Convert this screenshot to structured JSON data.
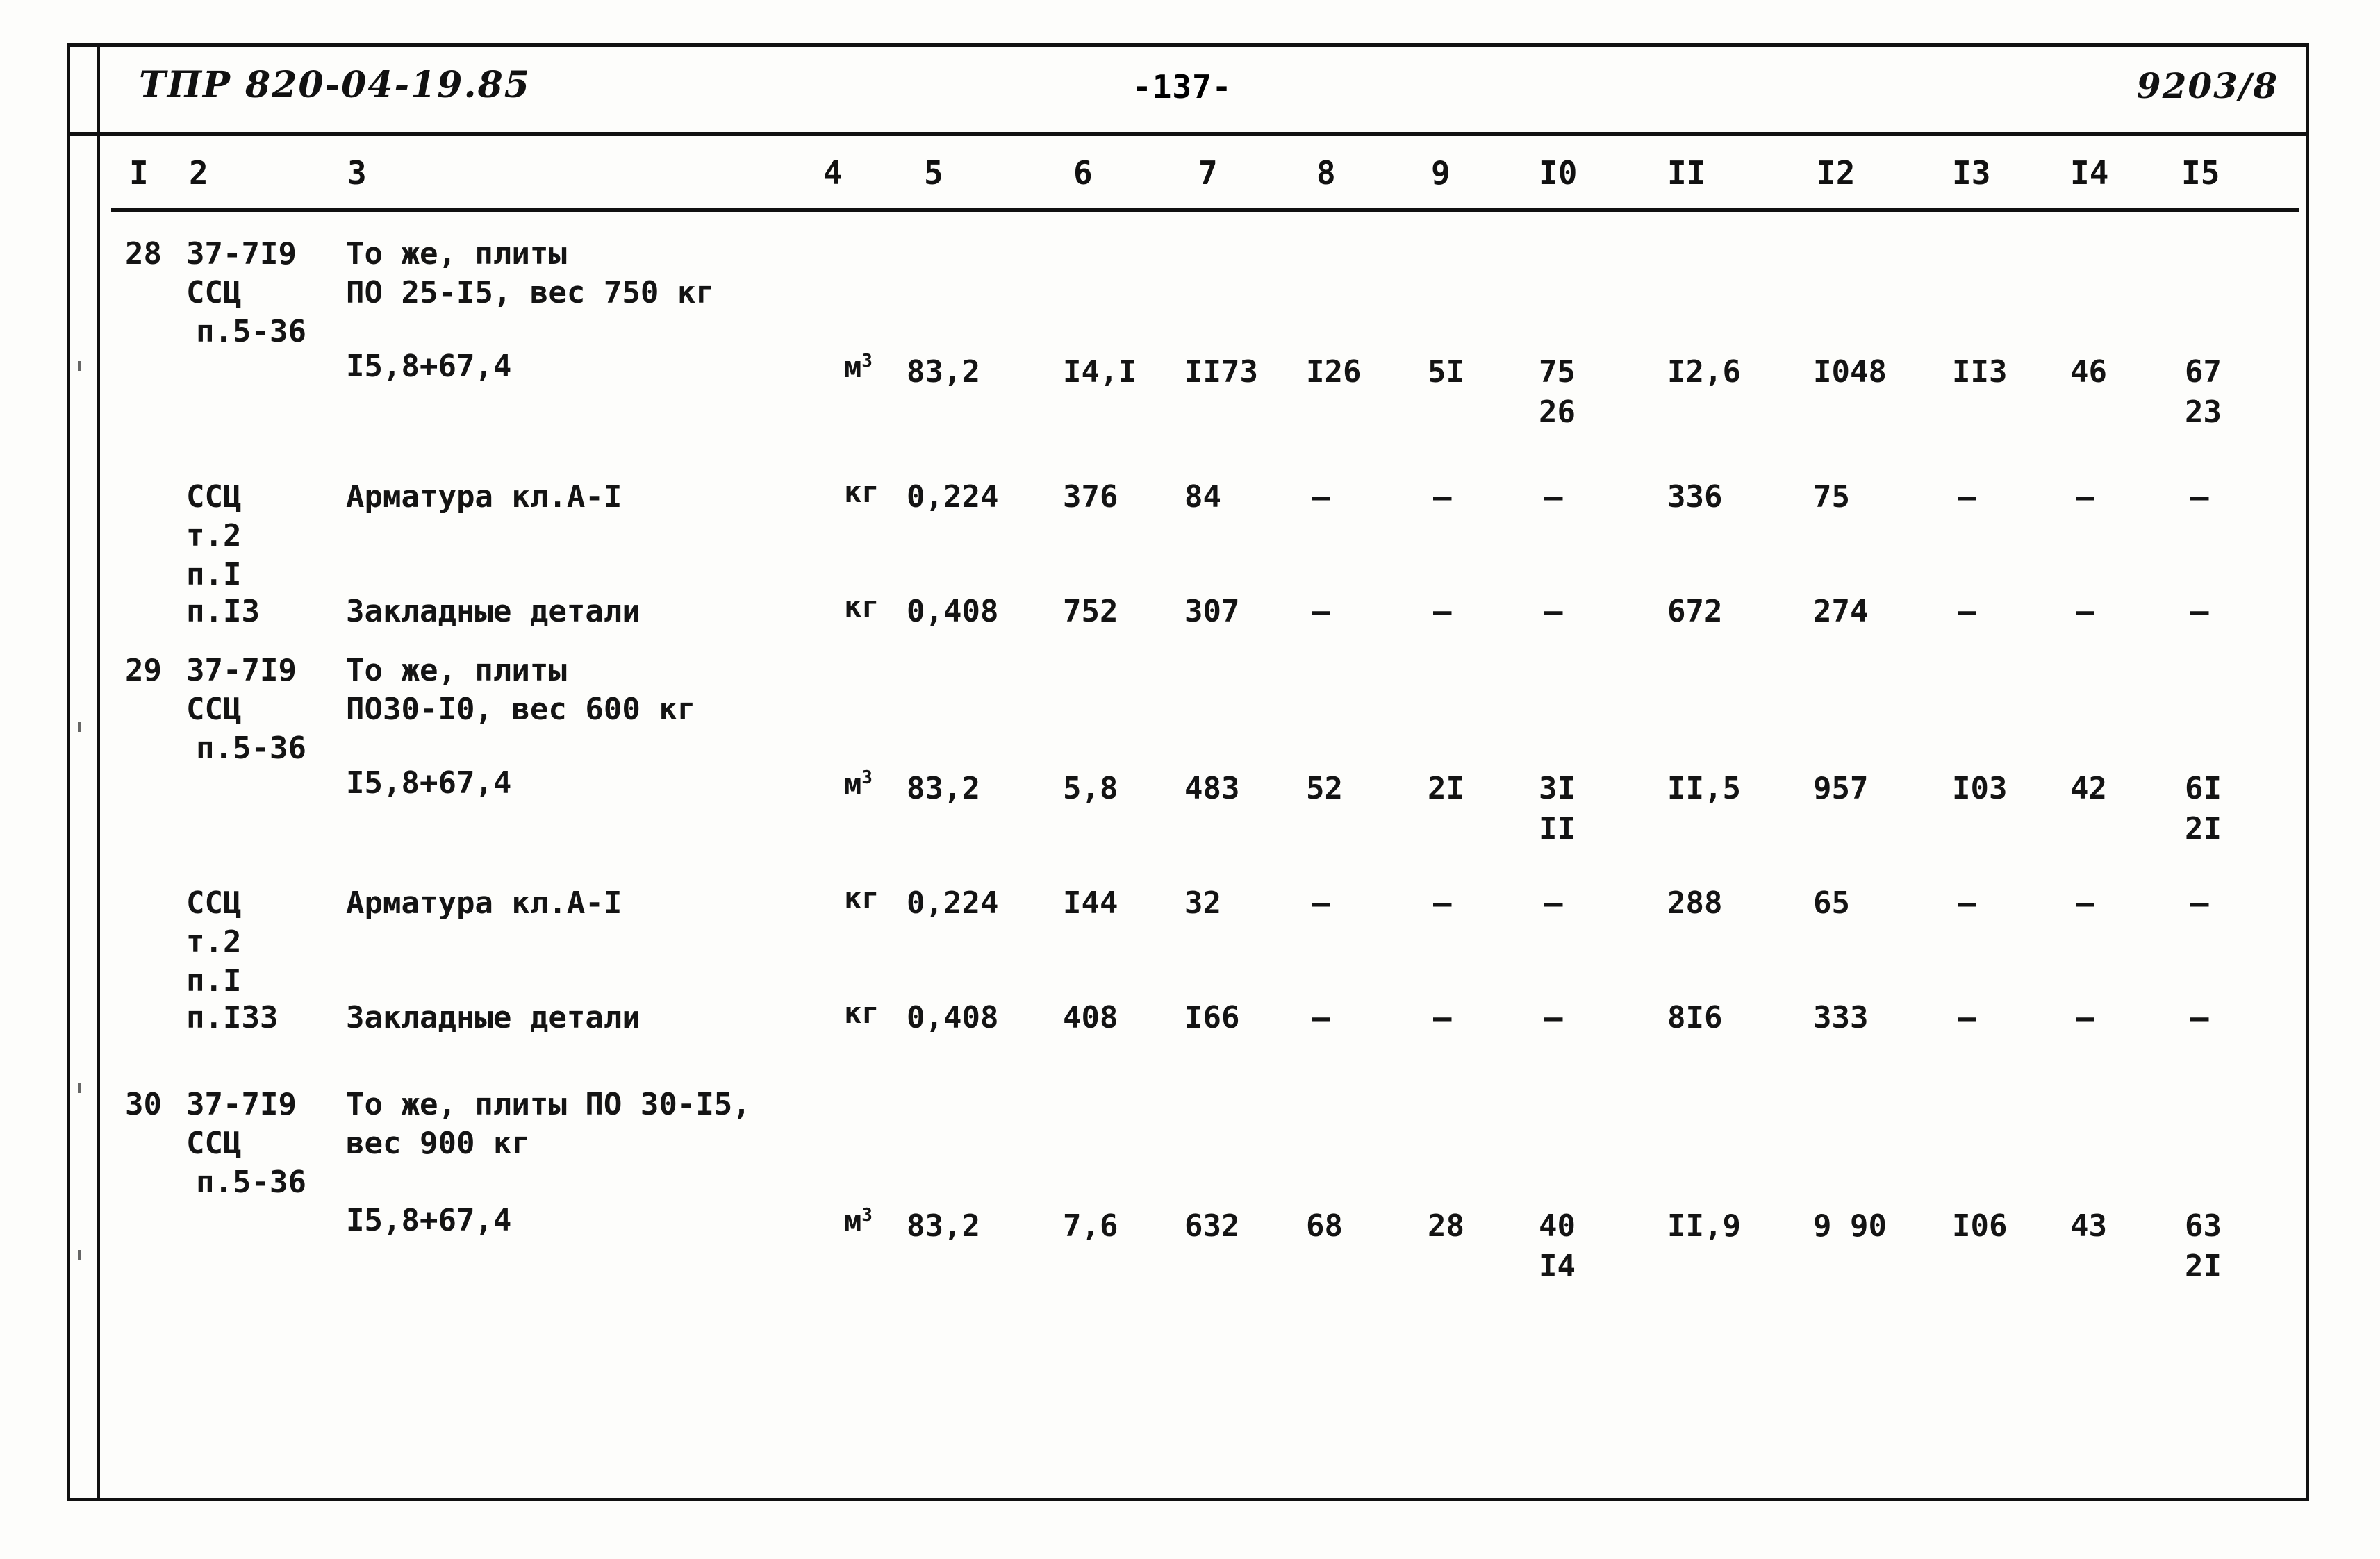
{
  "header": {
    "doc_code": "ТПР 820-04-19.85",
    "page_number": "-137-",
    "sheet_code": "9203/8"
  },
  "table": {
    "column_headers": [
      "I",
      "2",
      "3",
      "4",
      "5",
      "6",
      "7",
      "8",
      "9",
      "I0",
      "II",
      "I2",
      "I3",
      "I4",
      "I5"
    ],
    "rows": [
      {
        "id": "row-28",
        "c1": "28",
        "c2_lines": [
          "37-7I9",
          "ССЦ",
          "п.5-36"
        ],
        "c3_lines": [
          "То же, плиты",
          "ПО 25-I5, вес 750 кг",
          "I5,8+67,4"
        ],
        "c4": "м",
        "c4_sup": "3",
        "c5": "83,2",
        "c6": "I4,I",
        "c7": "II73",
        "c8": "I26",
        "c9": "5I",
        "c10": "75",
        "c10b": "26",
        "c11": "I2,6",
        "c12": "I048",
        "c13": "II3",
        "c14": "46",
        "c15": "67",
        "c15b": "23"
      },
      {
        "id": "row-28-armatura",
        "c1": "",
        "c2_lines": [
          "ССЦ",
          "т.2",
          "п.I"
        ],
        "c3_lines": [
          "Арматура кл.А-I"
        ],
        "c4": "кг",
        "c4_sup": "",
        "c5": "0,224",
        "c6": "376",
        "c7": "84",
        "c8": "-",
        "c9": "-",
        "c10": "-",
        "c11": "336",
        "c12": "75",
        "c13": "-",
        "c14": "-",
        "c15": "-"
      },
      {
        "id": "row-28-zakladnye",
        "c1": "",
        "c2_lines": [
          "п.I3"
        ],
        "c3_lines": [
          "Закладные детали"
        ],
        "c4": "кг",
        "c4_sup": "",
        "c5": "0,408",
        "c6": "752",
        "c7": "307",
        "c8": "-",
        "c9": "-",
        "c10": "-",
        "c11": "672",
        "c12": "274",
        "c13": "-",
        "c14": "-",
        "c15": "-"
      },
      {
        "id": "row-29",
        "c1": "29",
        "c2_lines": [
          "37-7I9",
          "ССЦ",
          "п.5-36"
        ],
        "c3_lines": [
          "То же, плиты",
          "ПО30-I0, вес 600 кг",
          "I5,8+67,4"
        ],
        "c4": "м",
        "c4_sup": "3",
        "c5": "83,2",
        "c6": "5,8",
        "c7": "483",
        "c8": "52",
        "c9": "2I",
        "c10": "3I",
        "c10b": "II",
        "c11": "II,5",
        "c12": "957",
        "c13": "I03",
        "c14": "42",
        "c15": "6I",
        "c15b": "2I"
      },
      {
        "id": "row-29-armatura",
        "c1": "",
        "c2_lines": [
          "ССЦ",
          "т.2",
          "п.I"
        ],
        "c3_lines": [
          "Арматура кл.А-I"
        ],
        "c4": "кг",
        "c4_sup": "",
        "c5": "0,224",
        "c6": "I44",
        "c7": "32",
        "c8": "-",
        "c9": "-",
        "c10": "-",
        "c11": "288",
        "c12": "65",
        "c13": "-",
        "c14": "-",
        "c15": "-"
      },
      {
        "id": "row-29-zakladnye",
        "c1": "",
        "c2_lines": [
          "п.I33"
        ],
        "c3_lines": [
          "Закладные детали"
        ],
        "c4": "кг",
        "c4_sup": "",
        "c5": "0,408",
        "c6": "408",
        "c7": "I66",
        "c8": "-",
        "c9": "-",
        "c10": "-",
        "c11": "8I6",
        "c12": "333",
        "c13": "-",
        "c14": "-",
        "c15": "-"
      },
      {
        "id": "row-30",
        "c1": "30",
        "c2_lines": [
          "37-7I9",
          "ССЦ",
          "п.5-36"
        ],
        "c3_lines": [
          "То же, плиты ПО 30-I5,",
          "вес 900 кг",
          "I5,8+67,4"
        ],
        "c4": "м",
        "c4_sup": "3",
        "c5": "83,2",
        "c6": "7,6",
        "c7": "632",
        "c8": "68",
        "c9": "28",
        "c10": "40",
        "c10b": "I4",
        "c11": "II,9",
        "c12": "9 90",
        "c13": "I06",
        "c14": "43",
        "c15": "63",
        "c15b": "2I"
      }
    ]
  }
}
